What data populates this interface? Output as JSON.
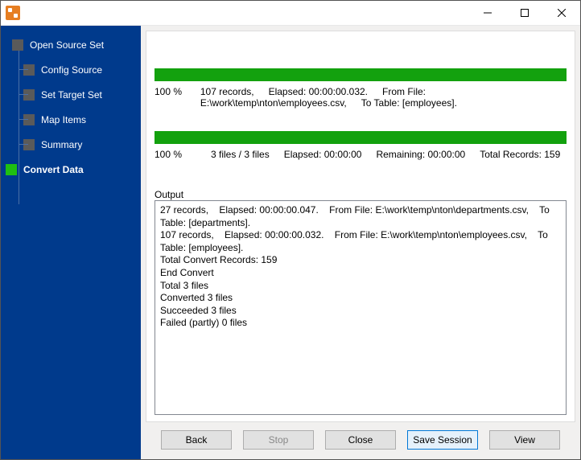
{
  "sidebar": {
    "items": [
      {
        "label": "Open Source Set"
      },
      {
        "label": "Config Source"
      },
      {
        "label": "Set Target Set"
      },
      {
        "label": "Map Items"
      },
      {
        "label": "Summary"
      },
      {
        "label": "Convert Data"
      }
    ]
  },
  "progress1": {
    "percent": "100 %",
    "records": "107 records,",
    "file_path": "E:\\work\\temp\\nton\\employees.csv,",
    "elapsed": "Elapsed: 00:00:00.032.",
    "from_label": "From File:",
    "to_label": "To Table: [employees]."
  },
  "progress2": {
    "percent": "100 %",
    "files": "3 files / 3 files",
    "elapsed": "Elapsed: 00:00:00",
    "remaining": "Remaining: 00:00:00",
    "total": "Total Records: 159"
  },
  "output": {
    "label": "Output",
    "lines": "27 records,    Elapsed: 00:00:00.047.    From File: E:\\work\\temp\\nton\\departments.csv,    To Table: [departments].\n107 records,    Elapsed: 00:00:00.032.    From File: E:\\work\\temp\\nton\\employees.csv,    To Table: [employees].\nTotal Convert Records: 159\nEnd Convert\nTotal 3 files\nConverted 3 files\nSucceeded 3 files\nFailed (partly) 0 files"
  },
  "buttons": {
    "back": "Back",
    "stop": "Stop",
    "close": "Close",
    "save": "Save Session",
    "view": "View"
  }
}
